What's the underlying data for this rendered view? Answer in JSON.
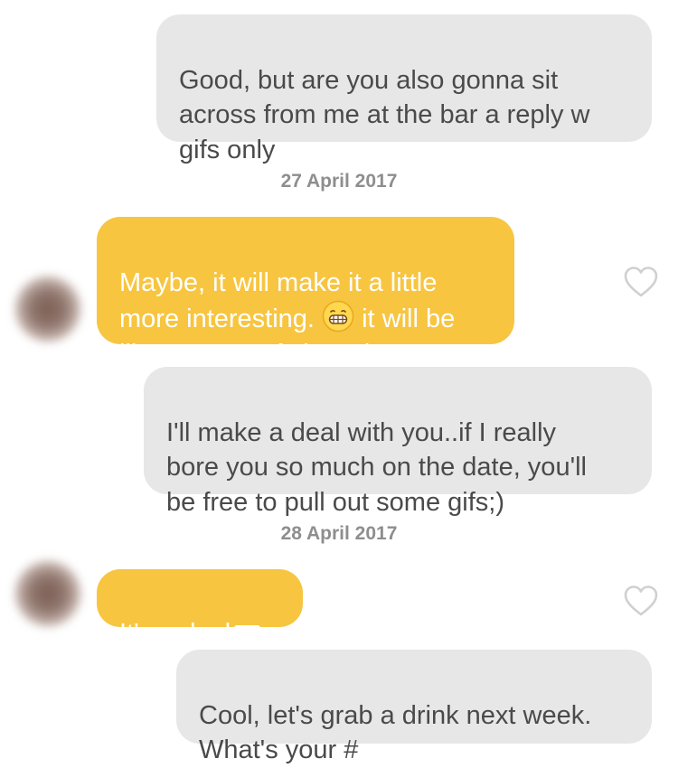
{
  "conversation": {
    "messages": [
      {
        "direction": "sent",
        "text": "Good, but are you also gonna sit\nacross from me at the bar a reply w\ngifs only"
      },
      {
        "direction": "received",
        "text_before_emoji": "Maybe, it will make it a little\nmore interesting. ",
        "emoji": "grimacing-face",
        "text_after_emoji": " it will be\nlike a game of charades.",
        "liked": false
      },
      {
        "direction": "sent",
        "text": "I'll make a deal with you..if I really\nbore you so much on the date, you'll\nbe free to pull out some gifs;)"
      },
      {
        "direction": "received",
        "text": "It's a deal",
        "unrendered_glyph": "?",
        "liked": false
      },
      {
        "direction": "sent",
        "text": "Cool, let's grab a drink next week.\nWhat's your #"
      }
    ],
    "date_separators": [
      "27 April 2017",
      "28 April 2017"
    ]
  },
  "colors": {
    "sent_bubble": "#e7e7e7",
    "sent_text": "#4a4a4a",
    "received_bubble": "#f7c540",
    "received_text": "#ffffff",
    "date_text": "#8e8e8e",
    "heart_outline": "#d0d0d0"
  }
}
